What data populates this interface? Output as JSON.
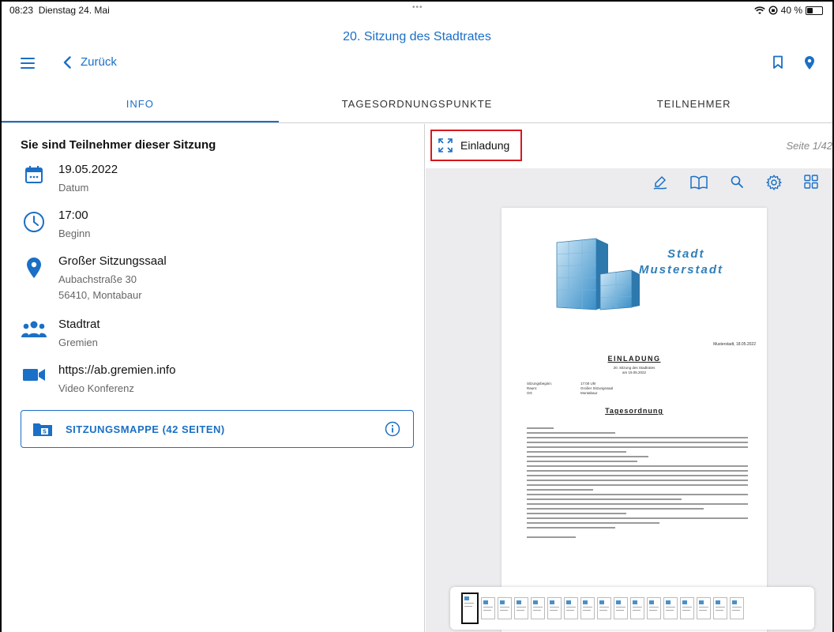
{
  "status": {
    "time": "08:23",
    "date": "Dienstag 24. Mai",
    "battery": "40 %",
    "battery_level": 0.4
  },
  "app": {
    "title": "20. Sitzung des Stadtrates"
  },
  "nav": {
    "back_label": "Zurück"
  },
  "tabs": [
    {
      "label": "INFO",
      "active": true
    },
    {
      "label": "TAGESORDNUNGSPUNKTE",
      "active": false
    },
    {
      "label": "TEILNEHMER",
      "active": false
    }
  ],
  "info": {
    "heading": "Sie sind Teilnehmer dieser Sitzung",
    "date": {
      "value": "19.05.2022",
      "label": "Datum"
    },
    "time": {
      "value": "17:00",
      "label": "Beginn"
    },
    "location": {
      "value": "Großer Sitzungssaal",
      "street": "Aubachstraße 30",
      "city": "56410,  Montabaur"
    },
    "gremium": {
      "value": "Stadtrat",
      "label": "Gremien"
    },
    "video": {
      "value": "https://ab.gremien.info",
      "label": "Video Konferenz"
    },
    "mappe_label": "SITZUNGSMAPPE (42 SEITEN)"
  },
  "document": {
    "title": "Einladung",
    "page_indicator": "Seite 1/42",
    "stadt_line1": "Stadt",
    "stadt_line2": "Musterstadt",
    "dateline": "Musterstadt, 18.05.2022",
    "einladung_heading": "EINLADUNG",
    "subheading_line1": "20. Sitzung des Stadtrates",
    "subheading_line2": "am 19.05.2022",
    "meta_labels": [
      "Sitzungsbeginn:",
      "Raum:",
      "Ort:"
    ],
    "meta_values": [
      "17:00 Uhr",
      "Großer Sitzungssaal",
      "Montabaur"
    ],
    "tagesordnung_heading": "Tagesordnung"
  },
  "thumbnails": {
    "count": 17,
    "selected_index": 0
  },
  "colors": {
    "accent": "#1a6fc6",
    "highlight": "#d6181e"
  }
}
